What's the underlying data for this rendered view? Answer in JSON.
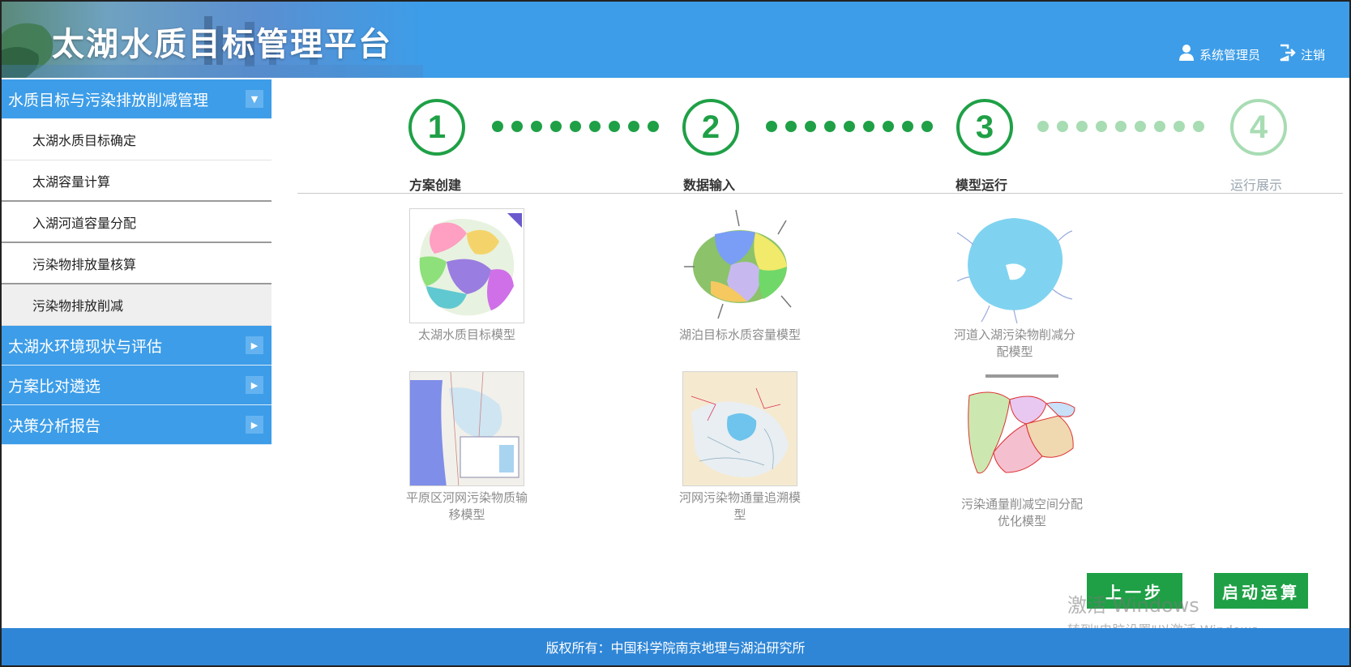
{
  "header": {
    "title": "太湖水质目标管理平台",
    "user_label": "系统管理员",
    "logout_label": "注销"
  },
  "sidebar": {
    "groups": [
      {
        "label": "水质目标与污染排放削减管理",
        "expanded": true,
        "items": [
          {
            "label": "太湖水质目标确定"
          },
          {
            "label": "太湖容量计算"
          },
          {
            "label": "入湖河道容量分配"
          },
          {
            "label": "污染物排放量核算"
          },
          {
            "label": "污染物排放削减",
            "active": true
          }
        ]
      },
      {
        "label": "太湖水环境现状与评估",
        "expanded": false
      },
      {
        "label": "方案比对遴选",
        "expanded": false
      },
      {
        "label": "决策分析报告",
        "expanded": false
      }
    ]
  },
  "steps": [
    {
      "number": "1",
      "label": "方案创建",
      "state": "done"
    },
    {
      "number": "2",
      "label": "数据输入",
      "state": "done"
    },
    {
      "number": "3",
      "label": "模型运行",
      "state": "current"
    },
    {
      "number": "4",
      "label": "运行展示",
      "state": "future"
    }
  ],
  "models": [
    {
      "caption": "太湖水质目标模型"
    },
    {
      "caption": "湖泊目标水质容量模型"
    },
    {
      "caption": "河道入湖污染物削减分配模型"
    },
    {
      "caption": "平原区河网污染物质输移模型"
    },
    {
      "caption": "河网污染物通量追溯模型"
    },
    {
      "caption": "污染通量削减空间分配优化模型"
    }
  ],
  "buttons": {
    "prev": "上一步",
    "run": "启动运算"
  },
  "watermark": {
    "line1": "激活 Windows",
    "line2": "转到\"电脑设置\"以激活 Windows。"
  },
  "footer": {
    "copyright": "版权所有：中国科学院南京地理与湖泊研究所"
  },
  "colors": {
    "header_blue": "#3d9de8",
    "footer_blue": "#2f86d6",
    "step_green": "#1fa046",
    "step_future": "#a8dcb3"
  }
}
